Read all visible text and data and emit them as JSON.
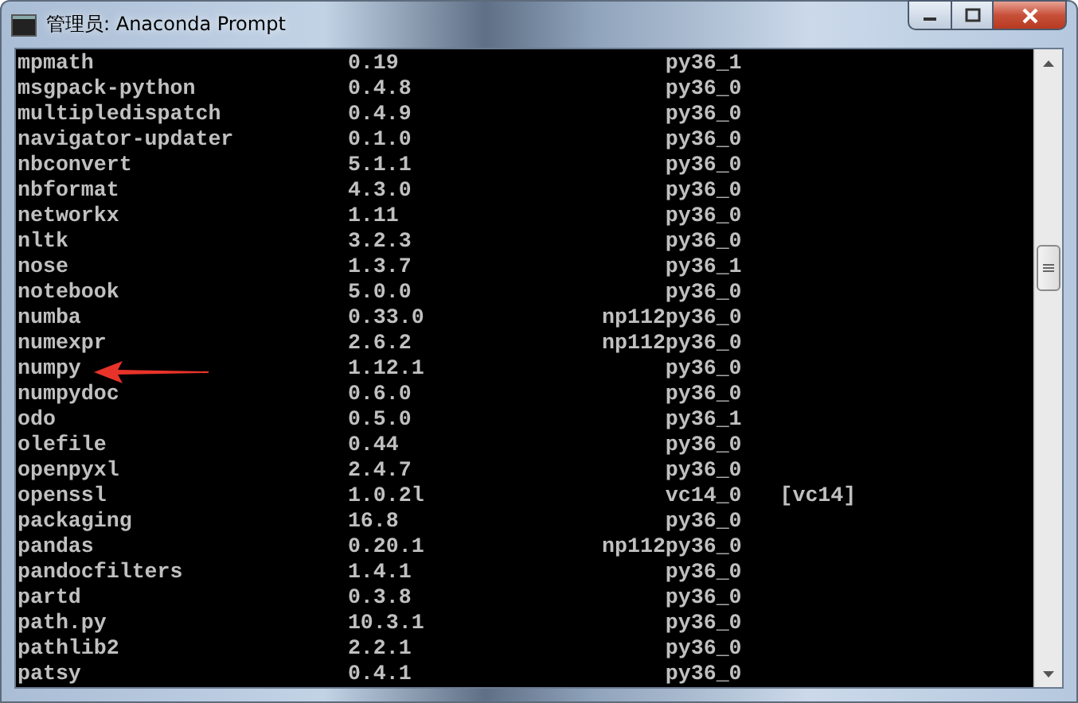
{
  "window": {
    "title": "管理员: Anaconda Prompt"
  },
  "packages": [
    {
      "name": "mpmath",
      "version": "0.19",
      "build": "py36_1"
    },
    {
      "name": "msgpack-python",
      "version": "0.4.8",
      "build": "py36_0"
    },
    {
      "name": "multipledispatch",
      "version": "0.4.9",
      "build": "py36_0"
    },
    {
      "name": "navigator-updater",
      "version": "0.1.0",
      "build": "py36_0"
    },
    {
      "name": "nbconvert",
      "version": "5.1.1",
      "build": "py36_0"
    },
    {
      "name": "nbformat",
      "version": "4.3.0",
      "build": "py36_0"
    },
    {
      "name": "networkx",
      "version": "1.11",
      "build": "py36_0"
    },
    {
      "name": "nltk",
      "version": "3.2.3",
      "build": "py36_0"
    },
    {
      "name": "nose",
      "version": "1.3.7",
      "build": "py36_1"
    },
    {
      "name": "notebook",
      "version": "5.0.0",
      "build": "py36_0"
    },
    {
      "name": "numba",
      "version": "0.33.0",
      "build": "np112py36_0"
    },
    {
      "name": "numexpr",
      "version": "2.6.2",
      "build": "np112py36_0"
    },
    {
      "name": "numpy",
      "version": "1.12.1",
      "build": "py36_0"
    },
    {
      "name": "numpydoc",
      "version": "0.6.0",
      "build": "py36_0"
    },
    {
      "name": "odo",
      "version": "0.5.0",
      "build": "py36_1"
    },
    {
      "name": "olefile",
      "version": "0.44",
      "build": "py36_0"
    },
    {
      "name": "openpyxl",
      "version": "2.4.7",
      "build": "py36_0"
    },
    {
      "name": "openssl",
      "version": "1.0.2l",
      "build": "vc14_0",
      "channel": "[vc14]"
    },
    {
      "name": "packaging",
      "version": "16.8",
      "build": "py36_0"
    },
    {
      "name": "pandas",
      "version": "0.20.1",
      "build": "np112py36_0"
    },
    {
      "name": "pandocfilters",
      "version": "1.4.1",
      "build": "py36_0"
    },
    {
      "name": "partd",
      "version": "0.3.8",
      "build": "py36_0"
    },
    {
      "name": "path.py",
      "version": "10.3.1",
      "build": "py36_0"
    },
    {
      "name": "pathlib2",
      "version": "2.2.1",
      "build": "py36_0"
    },
    {
      "name": "patsy",
      "version": "0.4.1",
      "build": "py36_0"
    }
  ]
}
